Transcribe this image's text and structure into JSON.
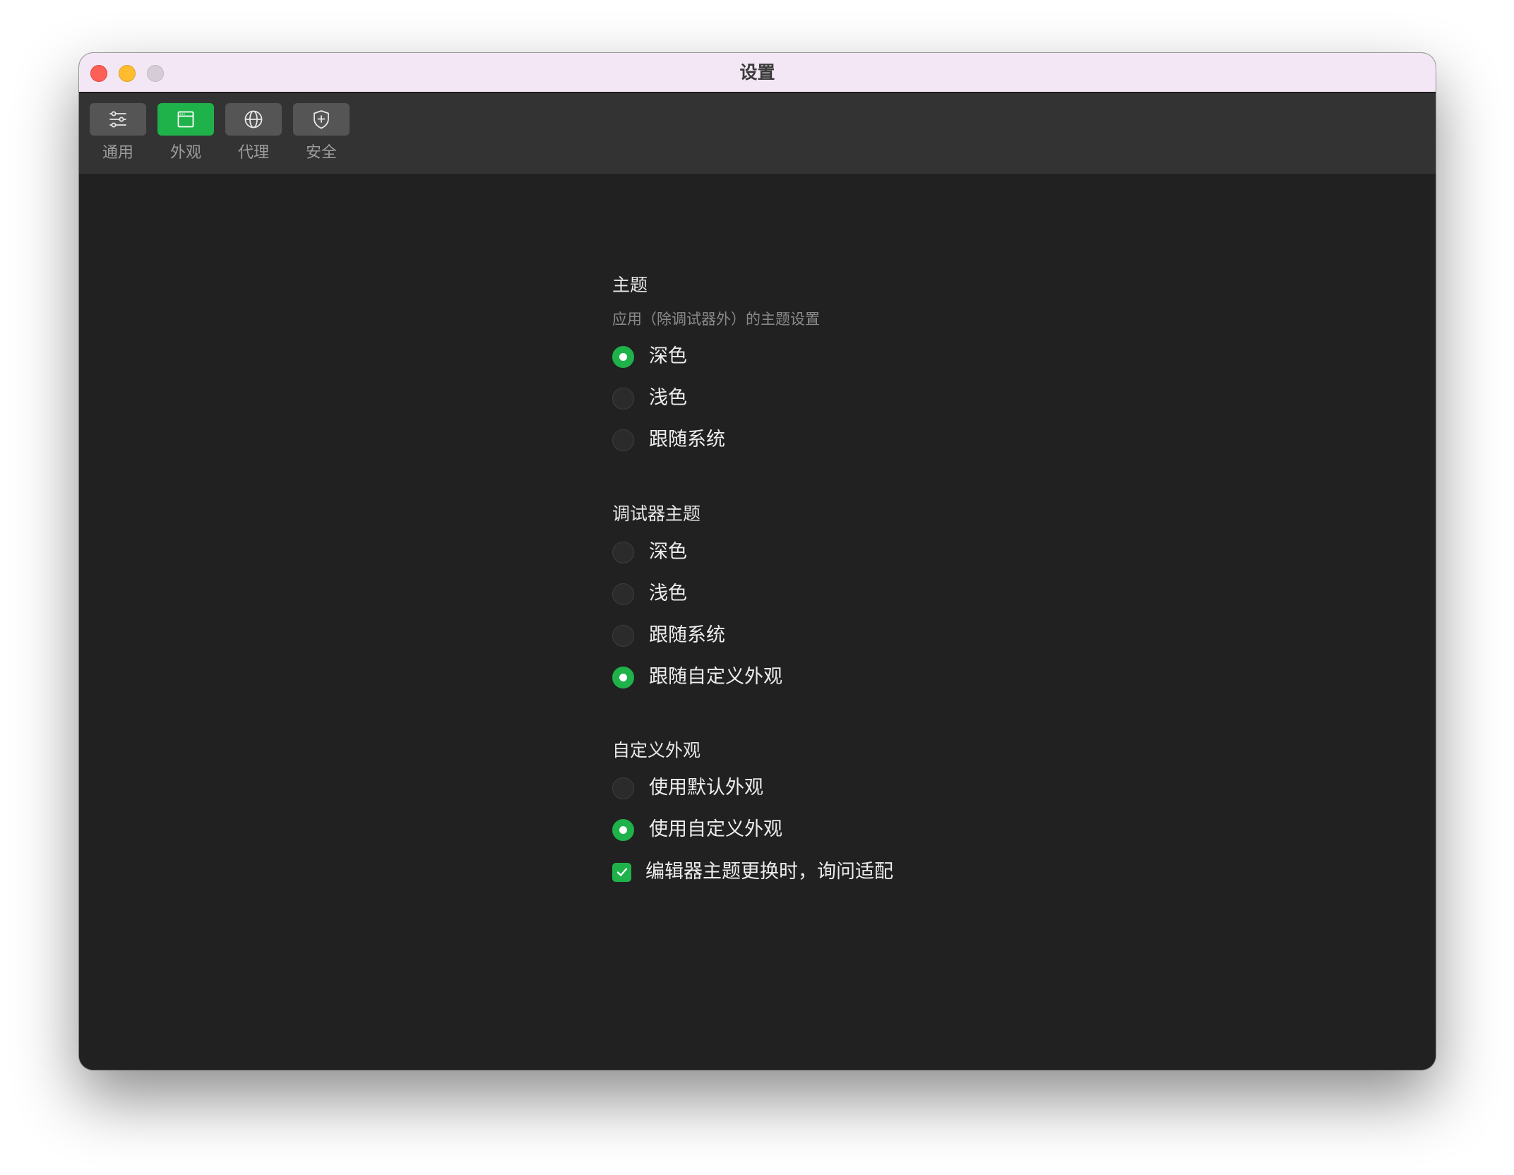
{
  "window": {
    "title": "设置"
  },
  "toolbar": {
    "items": [
      {
        "label": "通用",
        "icon": "sliders-icon",
        "active": false
      },
      {
        "label": "外观",
        "icon": "window-icon",
        "active": true
      },
      {
        "label": "代理",
        "icon": "globe-icon",
        "active": false
      },
      {
        "label": "安全",
        "icon": "shield-icon",
        "active": false
      }
    ]
  },
  "theme": {
    "title": "主题",
    "description": "应用（除调试器外）的主题设置",
    "options": [
      {
        "label": "深色",
        "selected": true
      },
      {
        "label": "浅色",
        "selected": false
      },
      {
        "label": "跟随系统",
        "selected": false
      }
    ]
  },
  "debugger_theme": {
    "title": "调试器主题",
    "options": [
      {
        "label": "深色",
        "selected": false
      },
      {
        "label": "浅色",
        "selected": false
      },
      {
        "label": "跟随系统",
        "selected": false
      },
      {
        "label": "跟随自定义外观",
        "selected": true
      }
    ]
  },
  "custom_appearance": {
    "title": "自定义外观",
    "options": [
      {
        "label": "使用默认外观",
        "selected": false
      },
      {
        "label": "使用自定义外观",
        "selected": true
      }
    ],
    "checkbox": {
      "label": "编辑器主题更换时，询问适配",
      "checked": true
    }
  },
  "colors": {
    "accent": "#1fb24a",
    "background": "#212121",
    "toolbar": "#333333",
    "titlebar": "#f3e7f5"
  }
}
